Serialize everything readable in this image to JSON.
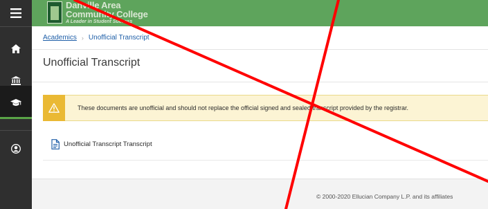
{
  "nav_rail": {
    "items": [
      {
        "name": "menu",
        "icon": "hamburger-menu-icon"
      },
      {
        "name": "home",
        "icon": "home-icon"
      },
      {
        "name": "finance",
        "icon": "bank-icon"
      },
      {
        "name": "academics",
        "icon": "graduation-cap-icon",
        "active": true
      },
      {
        "name": "profile",
        "icon": "user-circle-icon"
      }
    ],
    "colors": {
      "background": "#2f2f2f",
      "active_background": "#1b1b1b",
      "active_accent": "#5aa447"
    }
  },
  "header": {
    "brand_color": "#5ea45c",
    "logo": {
      "line1": "Danville Area",
      "line2": "Community College",
      "tagline": "A Leader in Student Success"
    }
  },
  "breadcrumb": {
    "parent": "Academics",
    "current": "Unofficial Transcript",
    "separator": "›"
  },
  "page": {
    "title": "Unofficial Transcript"
  },
  "alert": {
    "icon": "warning-triangle-icon",
    "text": "These documents are unofficial and should not replace the official signed and sealed transcript provided by the registrar.",
    "background": "#fcf4d4",
    "icon_background": "#eab934"
  },
  "documents": [
    {
      "icon": "document-icon",
      "label": "Unofficial Transcript Transcript"
    }
  ],
  "footer": {
    "copyright": "© 2000-2020 Ellucian Company L.P. and its affiliates"
  },
  "overlay": {
    "description_icon": "red-x-mark",
    "color": "#ff0000"
  }
}
